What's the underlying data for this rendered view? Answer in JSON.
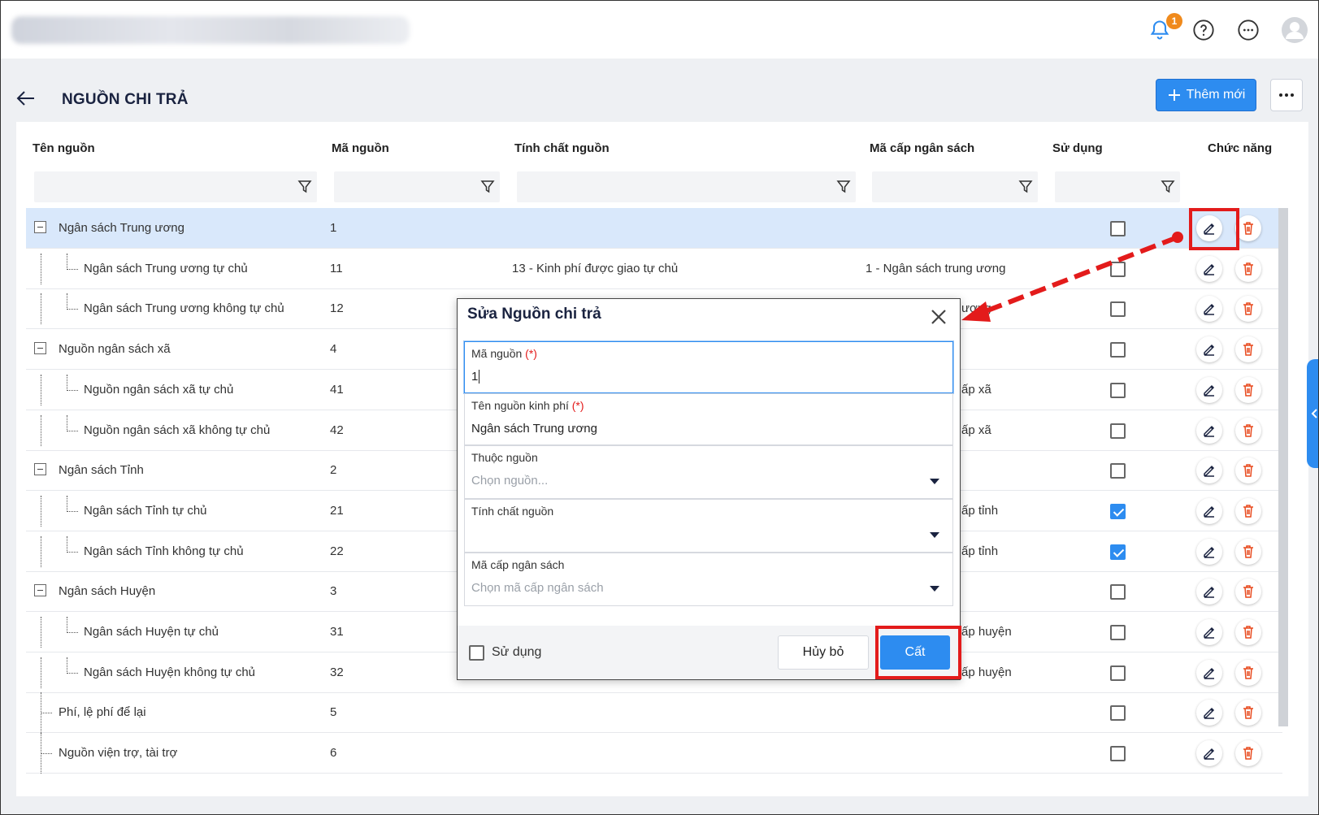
{
  "header": {
    "notification_count": "1",
    "icons": [
      "bell-icon",
      "help-icon",
      "more-icon",
      "avatar"
    ]
  },
  "page": {
    "title": "NGUỒN CHI TRẢ",
    "add_button": "Thêm mới"
  },
  "table": {
    "columns": [
      "Tên nguồn",
      "Mã nguồn",
      "Tính chất nguồn",
      "Mã cấp ngân sách",
      "Sử dụng",
      "Chức năng"
    ],
    "rows": [
      {
        "name": "Ngân sách Trung ương",
        "code": "1",
        "nature": "",
        "level": "",
        "used": false,
        "selected": true,
        "depth": 0,
        "group": true
      },
      {
        "name": "Ngân sách Trung ương tự chủ",
        "code": "11",
        "nature": "13 - Kinh phí được giao tự chủ",
        "level": "1 - Ngân sách trung ương",
        "used": false,
        "depth": 1
      },
      {
        "name": "Ngân sách Trung ương không tự chủ",
        "code": "12",
        "nature": "",
        "level": "ương",
        "used": false,
        "depth": 1
      },
      {
        "name": "Nguồn ngân sách xã",
        "code": "4",
        "nature": "",
        "level": "",
        "used": false,
        "depth": 0,
        "group": true
      },
      {
        "name": "Nguồn ngân sách xã tự chủ",
        "code": "41",
        "nature": "",
        "level": "ấp xã",
        "used": false,
        "depth": 1
      },
      {
        "name": "Nguồn ngân sách xã không tự chủ",
        "code": "42",
        "nature": "",
        "level": "ấp xã",
        "used": false,
        "depth": 1
      },
      {
        "name": "Ngân sách Tỉnh",
        "code": "2",
        "nature": "",
        "level": "",
        "used": false,
        "depth": 0,
        "group": true
      },
      {
        "name": "Ngân sách Tỉnh tự chủ",
        "code": "21",
        "nature": "",
        "level": "ấp tỉnh",
        "used": true,
        "depth": 1
      },
      {
        "name": "Ngân sách Tỉnh không tự chủ",
        "code": "22",
        "nature": "",
        "level": "ấp tỉnh",
        "used": true,
        "depth": 1
      },
      {
        "name": "Ngân sách Huyện",
        "code": "3",
        "nature": "",
        "level": "",
        "used": false,
        "depth": 0,
        "group": true
      },
      {
        "name": "Ngân sách Huyện tự chủ",
        "code": "31",
        "nature": "",
        "level": "ấp huyện",
        "used": false,
        "depth": 1
      },
      {
        "name": "Ngân sách Huyện không tự chủ",
        "code": "32",
        "nature": "",
        "level": "ấp huyện",
        "used": false,
        "depth": 1
      },
      {
        "name": "Phí, lệ phí để lại",
        "code": "5",
        "nature": "",
        "level": "",
        "used": false,
        "depth": 0,
        "group": false
      },
      {
        "name": "Nguồn viện trợ, tài trợ",
        "code": "6",
        "nature": "",
        "level": "",
        "used": false,
        "depth": 0,
        "group": false
      }
    ]
  },
  "modal": {
    "title": "Sửa Nguồn chi trả",
    "required_mark": "(*)",
    "fields": {
      "code_label": "Mã nguồn",
      "code_value": "1",
      "name_label": "Tên nguồn kinh phí",
      "name_value": "Ngân sách Trung ương",
      "parent_label": "Thuộc nguồn",
      "parent_placeholder": "Chọn nguồn...",
      "nature_label": "Tính chất nguồn",
      "nature_value": "",
      "level_label": "Mã cấp ngân sách",
      "level_placeholder": "Chọn mã cấp ngân sách"
    },
    "use_label": "Sử dụng",
    "cancel_label": "Hủy bỏ",
    "save_label": "Cất"
  },
  "colors": {
    "accent": "#2d8cf0",
    "highlight": "#e31b1b",
    "selected_row": "#d9e8fb",
    "badge": "#f08a1c"
  }
}
